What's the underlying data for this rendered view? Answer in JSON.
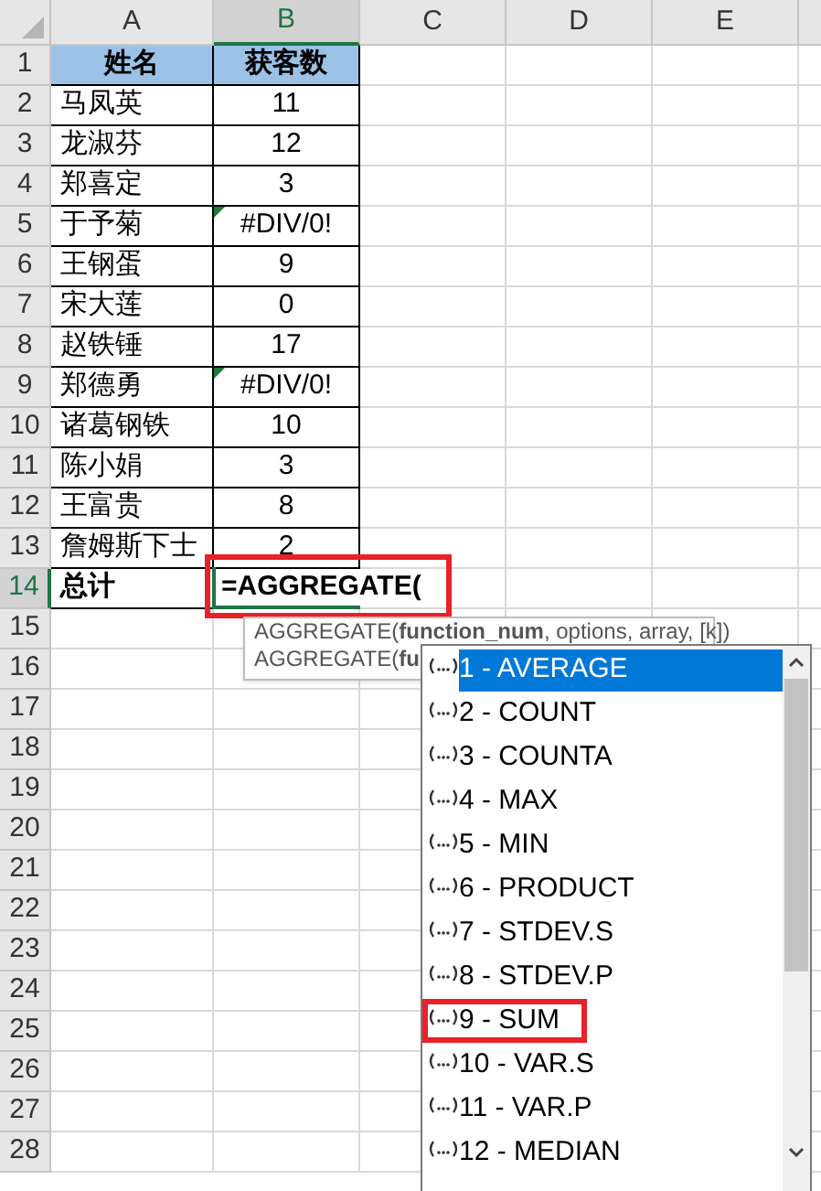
{
  "columns": [
    {
      "label": "A",
      "selected": false
    },
    {
      "label": "B",
      "selected": true
    },
    {
      "label": "C",
      "selected": false
    },
    {
      "label": "D",
      "selected": false
    },
    {
      "label": "E",
      "selected": false
    }
  ],
  "rows": [
    {
      "number": "1",
      "selected": false,
      "cells": [
        {
          "kind": "header",
          "text": "姓名"
        },
        {
          "kind": "header",
          "text": "获客数"
        }
      ]
    },
    {
      "number": "2",
      "selected": false,
      "cells": [
        {
          "kind": "name",
          "text": "马凤英"
        },
        {
          "kind": "value",
          "text": "11"
        }
      ]
    },
    {
      "number": "3",
      "selected": false,
      "cells": [
        {
          "kind": "name",
          "text": "龙淑芬"
        },
        {
          "kind": "value",
          "text": "12"
        }
      ]
    },
    {
      "number": "4",
      "selected": false,
      "cells": [
        {
          "kind": "name",
          "text": "郑喜定"
        },
        {
          "kind": "value",
          "text": "3"
        }
      ]
    },
    {
      "number": "5",
      "selected": false,
      "cells": [
        {
          "kind": "name",
          "text": "于予菊"
        },
        {
          "kind": "value",
          "text": "#DIV/0!",
          "error_flag": true
        }
      ]
    },
    {
      "number": "6",
      "selected": false,
      "cells": [
        {
          "kind": "name",
          "text": "王钢蛋"
        },
        {
          "kind": "value",
          "text": "9"
        }
      ]
    },
    {
      "number": "7",
      "selected": false,
      "cells": [
        {
          "kind": "name",
          "text": "宋大莲"
        },
        {
          "kind": "value",
          "text": "0"
        }
      ]
    },
    {
      "number": "8",
      "selected": false,
      "cells": [
        {
          "kind": "name",
          "text": "赵铁锤"
        },
        {
          "kind": "value",
          "text": "17"
        }
      ]
    },
    {
      "number": "9",
      "selected": false,
      "cells": [
        {
          "kind": "name",
          "text": "郑德勇"
        },
        {
          "kind": "value",
          "text": "#DIV/0!",
          "error_flag": true
        }
      ]
    },
    {
      "number": "10",
      "selected": false,
      "cells": [
        {
          "kind": "name",
          "text": "诸葛钢铁"
        },
        {
          "kind": "value",
          "text": "10"
        }
      ]
    },
    {
      "number": "11",
      "selected": false,
      "cells": [
        {
          "kind": "name",
          "text": "陈小娟"
        },
        {
          "kind": "value",
          "text": "3"
        }
      ]
    },
    {
      "number": "12",
      "selected": false,
      "cells": [
        {
          "kind": "name",
          "text": "王富贵"
        },
        {
          "kind": "value",
          "text": "8"
        }
      ]
    },
    {
      "number": "13",
      "selected": false,
      "cells": [
        {
          "kind": "name",
          "text": "詹姆斯下士"
        },
        {
          "kind": "value",
          "text": "2"
        }
      ]
    },
    {
      "number": "14",
      "selected": true,
      "cells": [
        {
          "kind": "total_label",
          "text": "总计"
        },
        {
          "kind": "formula",
          "text": "=AGGREGATE(",
          "highlighted": true
        }
      ]
    },
    {
      "number": "15",
      "selected": false
    },
    {
      "number": "16",
      "selected": false
    },
    {
      "number": "17",
      "selected": false
    },
    {
      "number": "18",
      "selected": false
    },
    {
      "number": "19",
      "selected": false
    },
    {
      "number": "20",
      "selected": false
    },
    {
      "number": "21",
      "selected": false
    },
    {
      "number": "22",
      "selected": false
    },
    {
      "number": "23",
      "selected": false
    },
    {
      "number": "24",
      "selected": false
    },
    {
      "number": "25",
      "selected": false
    },
    {
      "number": "26",
      "selected": false
    },
    {
      "number": "27",
      "selected": false
    },
    {
      "number": "28",
      "selected": false
    }
  ],
  "tooltip": {
    "lines": [
      "AGGREGATE(**function_num**, options, array, [k])",
      "AGGREGATE(**fu**"
    ]
  },
  "dropdown": {
    "items": [
      {
        "label": "1 - AVERAGE",
        "selected": true,
        "highlighted": false
      },
      {
        "label": "2 - COUNT",
        "selected": false,
        "highlighted": false
      },
      {
        "label": "3 - COUNTA",
        "selected": false,
        "highlighted": false
      },
      {
        "label": "4 - MAX",
        "selected": false,
        "highlighted": false
      },
      {
        "label": "5 - MIN",
        "selected": false,
        "highlighted": false
      },
      {
        "label": "6 - PRODUCT",
        "selected": false,
        "highlighted": false
      },
      {
        "label": "7 - STDEV.S",
        "selected": false,
        "highlighted": false
      },
      {
        "label": "8 - STDEV.P",
        "selected": false,
        "highlighted": false
      },
      {
        "label": "9 - SUM",
        "selected": false,
        "highlighted": true
      },
      {
        "label": "10 - VAR.S",
        "selected": false,
        "highlighted": false
      },
      {
        "label": "11 - VAR.P",
        "selected": false,
        "highlighted": false
      },
      {
        "label": "12 - MEDIAN",
        "selected": false,
        "highlighted": false
      }
    ]
  }
}
